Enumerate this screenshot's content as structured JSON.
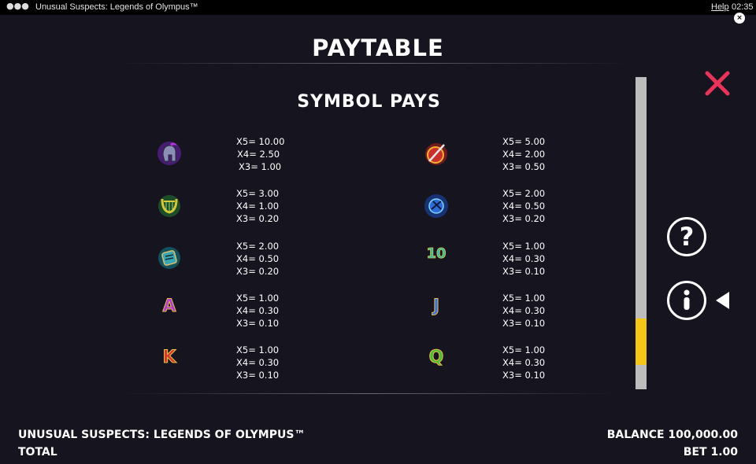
{
  "window": {
    "dots": "●●●",
    "title": "Unusual Suspects: Legends of Olympus™",
    "help": "Help",
    "clock": "02:35",
    "mini_close": "×"
  },
  "paytable": {
    "title": "PAYTABLE",
    "section_title": "SYMBOL PAYS"
  },
  "symbols": [
    {
      "icon": "spartan-helmet-icon",
      "x5": "X5= 10.00",
      "x4": "X4= 2.50",
      "x3": "X3= 1.00"
    },
    {
      "icon": "shield-sword-icon",
      "x5": "X5= 5.00",
      "x4": "X4= 2.00",
      "x3": "X3= 0.50"
    },
    {
      "icon": "lyre-icon",
      "x5": "X5= 3.00",
      "x4": "X4= 1.00",
      "x3": "X3= 0.20"
    },
    {
      "icon": "trident-orb-icon",
      "x5": "X5= 2.00",
      "x4": "X4= 0.50",
      "x3": "X3= 0.20"
    },
    {
      "icon": "scroll-book-icon",
      "x5": "X5= 2.00",
      "x4": "X4= 0.50",
      "x3": "X3= 0.20"
    },
    {
      "icon": "ten-card-icon",
      "label": "10",
      "x5": "X5= 1.00",
      "x4": "X4= 0.30",
      "x3": "X3= 0.10"
    },
    {
      "icon": "ace-card-icon",
      "label": "A",
      "x5": "X5= 1.00",
      "x4": "X4= 0.30",
      "x3": "X3= 0.10"
    },
    {
      "icon": "jack-card-icon",
      "label": "J",
      "x5": "X5= 1.00",
      "x4": "X4= 0.30",
      "x3": "X3= 0.10"
    },
    {
      "icon": "king-card-icon",
      "label": "K",
      "x5": "X5= 1.00",
      "x4": "X4= 0.30",
      "x3": "X3= 0.10"
    },
    {
      "icon": "queen-card-icon",
      "label": "Q",
      "x5": "X5= 1.00",
      "x4": "X4= 0.30",
      "x3": "X3= 0.10"
    }
  ],
  "controls": {
    "help_glyph": "?",
    "info_glyph": "i"
  },
  "footer": {
    "game_name": "UNUSUAL SUSPECTS: LEGENDS OF OLYMPUS™",
    "total_label": "TOTAL",
    "balance_label": "BALANCE",
    "balance_value": "100,000.00",
    "bet_label": "BET",
    "bet_value": "1.00"
  },
  "colors": {
    "background": "#15141f",
    "accent_close": "#e8335a",
    "scroll_thumb": "#f5c518",
    "scroll_track": "#bdbdbd"
  },
  "scroll": {
    "position_fraction": 0.78
  }
}
